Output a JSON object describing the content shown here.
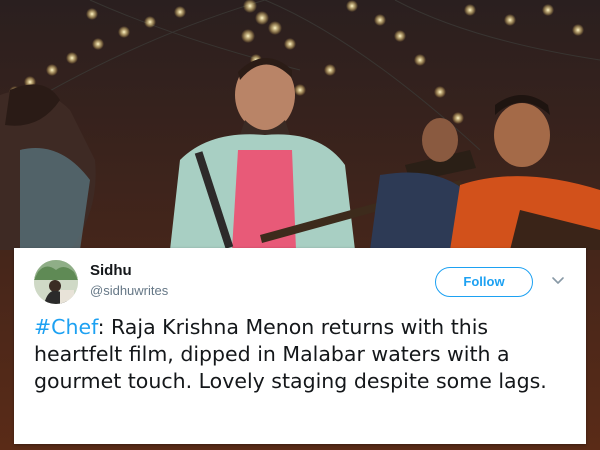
{
  "tweet": {
    "author_name": "Sidhu",
    "author_handle": "@sidhuwrites",
    "follow_label": "Follow",
    "hashtag": "#Chef",
    "body": ": Raja Krishna Menon returns with this heartfelt film, dipped in Malabar waters with a gourmet touch. Lovely staging despite some lags."
  },
  "icons": {
    "avatar": "avatar",
    "caret": "chevron-down-icon"
  },
  "colors": {
    "accent": "#1da1f2",
    "text": "#14171a",
    "muted": "#657786"
  }
}
